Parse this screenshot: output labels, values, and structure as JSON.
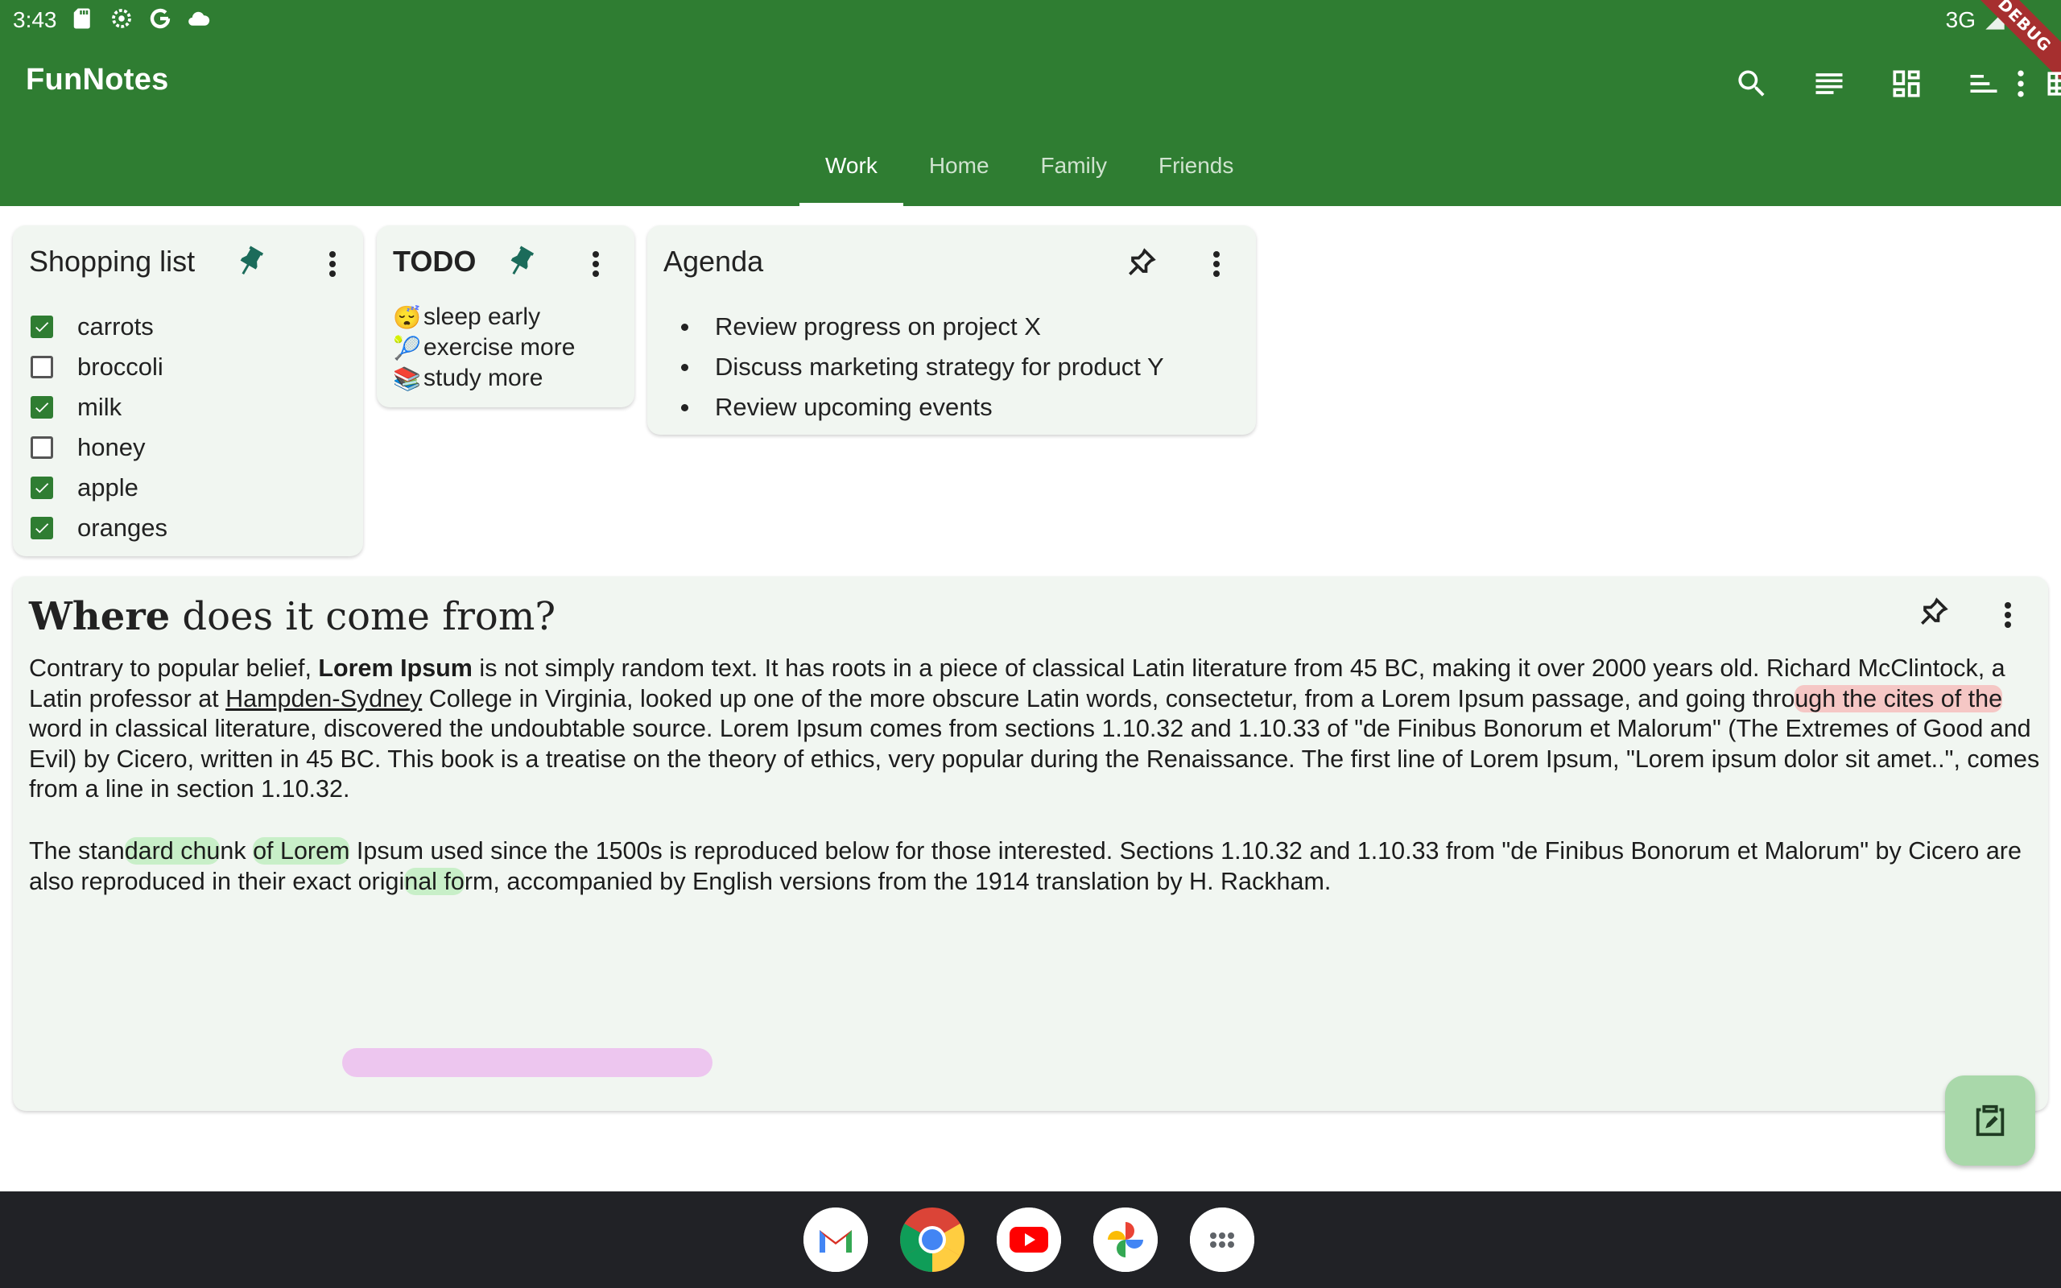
{
  "status_bar": {
    "time": "3:43",
    "network": "3G",
    "debug_label": "DEBUG"
  },
  "app": {
    "title": "FunNotes",
    "actions": [
      "search-icon",
      "list-view-icon",
      "dashboard-view-icon",
      "sort-icon",
      "grid-view-icon",
      "settings-icon",
      "more-vert-icon"
    ]
  },
  "tabs": [
    {
      "label": "Work",
      "active": true
    },
    {
      "label": "Home",
      "active": false
    },
    {
      "label": "Family",
      "active": false
    },
    {
      "label": "Friends",
      "active": false
    }
  ],
  "notes": {
    "shopping": {
      "title": "Shopping list",
      "pinned": true,
      "items": [
        {
          "label": "carrots",
          "checked": true
        },
        {
          "label": "broccoli",
          "checked": false
        },
        {
          "label": "milk",
          "checked": true
        },
        {
          "label": "honey",
          "checked": false
        },
        {
          "label": "apple",
          "checked": true
        },
        {
          "label": "oranges",
          "checked": true
        }
      ]
    },
    "todo": {
      "title": "TODO",
      "pinned": true,
      "items": [
        {
          "emoji": "😴",
          "label": "sleep early"
        },
        {
          "emoji": "🎾",
          "label": "exercise more"
        },
        {
          "emoji": "📚",
          "label": "study more"
        }
      ]
    },
    "agenda": {
      "title": "Agenda",
      "pinned": false,
      "items": [
        "Review progress on project X",
        "Discuss marketing strategy for product Y",
        "Review upcoming events"
      ]
    },
    "lorem": {
      "title_bold": "Where",
      "title_rest": " does it come from?",
      "pinned": false,
      "p1_a": "Contrary to popular belief, ",
      "p1_bold": "Lorem Ipsum",
      "p1_b": " is not simply random text. It has roots in a piece of classical Latin literature from 45 BC, making it over 2000 years old. Richard McClintock, a Latin professor at ",
      "p1_link": "Hampden-Sydney",
      "p1_c": " College in Virginia, looked up one of the more obscure Latin words, consectetur, from a Lorem Ipsum passage, and going thro",
      "p1_hl": "ugh the cites of the",
      "p1_d": " word in classical literature, discovered the undoubtable source. Lorem Ipsum comes from sections 1.10.32 and 1.10.33 of \"de Finibus Bonorum et Malorum\" (The Extremes of Good and Evil) by Cicero, written in 45 BC. This book is a treatise on the theory of ethics, very popular during the Renaissance. The first line of Lorem Ipsum, \"Lorem ipsum dolor sit amet..\", comes from a line in section 1.10.32.",
      "p2_a": "The stan",
      "p2_hl1": "dard chu",
      "p2_b": "nk ",
      "p2_hl2": "of Lorem",
      "p2_c": " Ipsum used since the 1500s is reproduced below for those interested. Sections 1.10.32 and 1.10.33 from \"de Finibus Bonorum et Malorum\" by Cicero are also reproduced in their exact origi",
      "p2_hl3": "nal fo",
      "p2_d": "rm, accompanied by English versions from the 1914 translation by H. Rackham."
    }
  },
  "dock": [
    "gmail-icon",
    "chrome-icon",
    "youtube-icon",
    "photos-icon",
    "app-drawer-icon"
  ],
  "colors": {
    "primary": "#2f7d32",
    "card": "#f1f6f1",
    "fab": "#a9d8aa",
    "pin_active": "#1b6b5a"
  }
}
